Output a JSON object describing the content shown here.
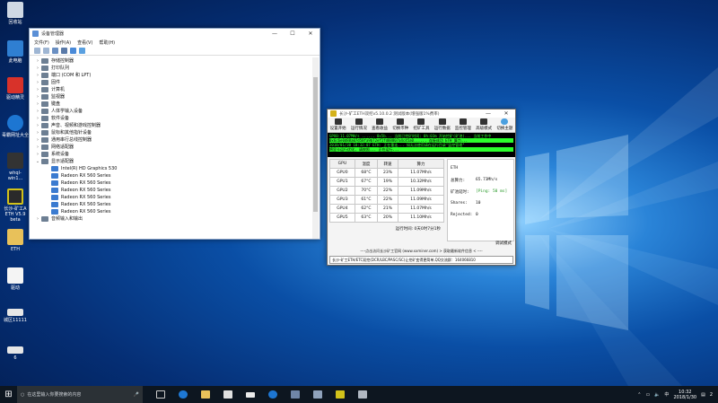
{
  "desktop_icons": [
    {
      "label": "回收站"
    },
    {
      "label": "此电脑"
    },
    {
      "label": "驱动精灵"
    },
    {
      "label": "毒霸网址大全"
    },
    {
      "label": "whql-win1..."
    },
    {
      "label": "长沙-矿工A ETH V5.9 beta"
    },
    {
      "label": "ETH"
    },
    {
      "label": "驱动"
    },
    {
      "label": "城区11111"
    },
    {
      "label": "6"
    }
  ],
  "device_manager": {
    "title": "设备管理器",
    "menus": [
      "文件(F)",
      "操作(A)",
      "查看(V)",
      "帮助(H)"
    ],
    "tree": [
      {
        "label": "存储控制器",
        "indent": false,
        "expanded": false
      },
      {
        "label": "打印队列",
        "indent": false,
        "expanded": false
      },
      {
        "label": "端口 (COM 和 LPT)",
        "indent": false,
        "expanded": false
      },
      {
        "label": "固件",
        "indent": false,
        "expanded": false
      },
      {
        "label": "计算机",
        "indent": false,
        "expanded": false
      },
      {
        "label": "监视器",
        "indent": false,
        "expanded": false
      },
      {
        "label": "键盘",
        "indent": false,
        "expanded": false
      },
      {
        "label": "人体学输入设备",
        "indent": false,
        "expanded": false
      },
      {
        "label": "软件设备",
        "indent": false,
        "expanded": false
      },
      {
        "label": "声音、视频和游戏控制器",
        "indent": false,
        "expanded": false
      },
      {
        "label": "鼠标和其他指针设备",
        "indent": false,
        "expanded": false
      },
      {
        "label": "通用串行总线控制器",
        "indent": false,
        "expanded": false
      },
      {
        "label": "网络适配器",
        "indent": false,
        "expanded": false
      },
      {
        "label": "系统设备",
        "indent": false,
        "expanded": false
      },
      {
        "label": "显示适配器",
        "indent": false,
        "expanded": true
      },
      {
        "label": "Intel(R) HD Graphics 530",
        "indent": true
      },
      {
        "label": "Radeon RX 560 Series",
        "indent": true
      },
      {
        "label": "Radeon RX 560 Series",
        "indent": true
      },
      {
        "label": "Radeon RX 560 Series",
        "indent": true
      },
      {
        "label": "Radeon RX 560 Series",
        "indent": true
      },
      {
        "label": "Radeon RX 560 Series",
        "indent": true
      },
      {
        "label": "Radeon RX 560 Series",
        "indent": true
      },
      {
        "label": "音频输入和输出",
        "indent": false,
        "expanded": false
      }
    ]
  },
  "miner": {
    "title": "长沙-矿工ETH双挖v5.10.0.2 测试版本(增强版1%费率)",
    "toolbar": [
      "设置开始",
      "运行情况",
      "查看收益",
      "切换币种",
      "挖矿工具",
      "运行数据",
      "监控管理",
      "高级模式",
      "切换主题"
    ],
    "console": [
      "GPU0:11.07MH/s ...... 0x5b... 当前已挖矿时间: 0h:03m 开始挖矿(矿池)... 当前工作中",
      "0x6c6e0d88a07d58fa9b72ef1fd88807a4c45a0...... 连接成功 ETH 算力...",
      "2018/01/30 10:32:07 ETH: 正在重连... 如无法使用请在运行目录\"监控管理\"",
      "将显卡运行优化, 请按照... 正在运行..."
    ],
    "table": {
      "headers": [
        "GPU",
        "温度",
        "转速",
        "算力"
      ],
      "rows": [
        [
          "GPU0",
          "68°C",
          "23%",
          "11.07Mh/s"
        ],
        [
          "GPU1",
          "67°C",
          "19%",
          "10.32Mh/s"
        ],
        [
          "GPU2",
          "70°C",
          "22%",
          "11.09Mh/s"
        ],
        [
          "GPU3",
          "61°C",
          "22%",
          "11.09Mh/s"
        ],
        [
          "GPU4",
          "62°C",
          "21%",
          "11.07Mh/s"
        ],
        [
          "GPU5",
          "63°C",
          "20%",
          "11.10Mh/s"
        ]
      ]
    },
    "stats": {
      "coin": "ETH",
      "hashrate_label": "总算力:",
      "hashrate_value": "65.73Mh/s",
      "pool_label": "矿池延时:",
      "pool_value": "[Ping: 50 ms]",
      "shares_label": "Shares:",
      "shares_value": "10",
      "rejected_label": "Rejected:",
      "rejected_value": "0"
    },
    "runtime": "运行时间: 0天0时7分1秒",
    "debug_mode": "调试模式",
    "footer_link": "----点击访问长沙矿工官网 (www.xxminer.com) > 获取最新软件信息 < ----",
    "footer_info": "长沙-矿工ETH/ETC双挖(DCR/LBC/PASC/SC)让挖矿变得更简单,QQ交流群：164066810"
  },
  "taskbar": {
    "search_placeholder": "在这里输入你要搜索的内容",
    "time": "10:32",
    "date": "2018/1/30",
    "ime": "中",
    "notifications": "2"
  }
}
